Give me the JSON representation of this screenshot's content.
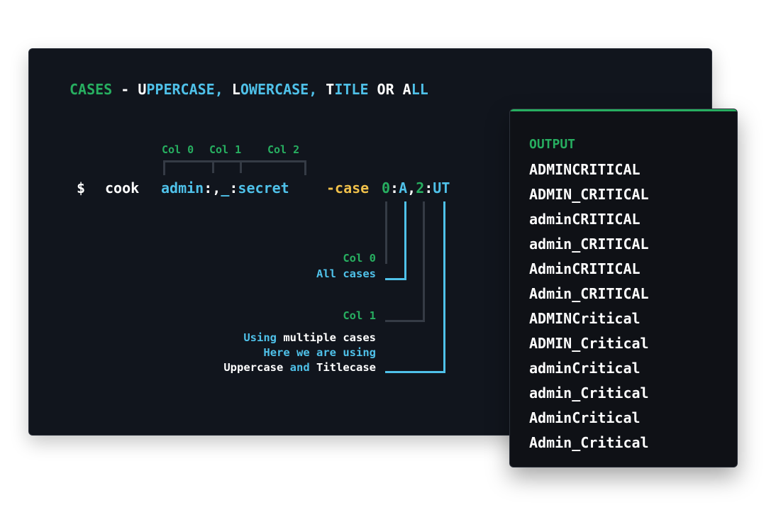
{
  "title": {
    "parts": [
      {
        "text": "CASES",
        "color": "#27ae60"
      },
      {
        "text": " - ",
        "color": "#ffffff"
      },
      {
        "text": "U",
        "color": "#ffffff"
      },
      {
        "text": "PPERCASE,",
        "color": "#4fc1e9"
      },
      {
        "text": " ",
        "color": "#ffffff"
      },
      {
        "text": "L",
        "color": "#ffffff"
      },
      {
        "text": "OWERCASE,",
        "color": "#4fc1e9"
      },
      {
        "text": " ",
        "color": "#ffffff"
      },
      {
        "text": "T",
        "color": "#ffffff"
      },
      {
        "text": "ITLE",
        "color": "#4fc1e9"
      },
      {
        "text": " OR ",
        "color": "#ffffff"
      },
      {
        "text": "A",
        "color": "#ffffff"
      },
      {
        "text": "LL",
        "color": "#4fc1e9"
      }
    ]
  },
  "columns": {
    "col0": "Col 0",
    "col1": "Col 1",
    "col2": "Col 2"
  },
  "command": {
    "prompt": "$",
    "program": "cook",
    "arg_admin": "admin",
    "arg_colon1": ":",
    "arg_comma": ",",
    "arg_underscore": "_",
    "arg_colon2": ":",
    "arg_secret": "secret",
    "flag": "-case",
    "v0": "0",
    "v_colon1": ":",
    "vA": "A",
    "v_comma": ",",
    "v2": "2",
    "v_colon2": ":",
    "vUT": "UT"
  },
  "annotations": {
    "a1_col": "Col 0",
    "a1_desc": "All cases",
    "a2_col": "Col 1",
    "a3_line1_a": "Using",
    "a3_line1_b": " multiple cases",
    "a3_line2": "Here we are using",
    "a3_line3_a": "Uppercase",
    "a3_line3_b": " and ",
    "a3_line3_c": "Titlecase"
  },
  "output": {
    "title": "OUTPUT",
    "lines": [
      "ADMINCRITICAL",
      "ADMIN_CRITICAL",
      "adminCRITICAL",
      "admin_CRITICAL",
      "AdminCRITICAL",
      "Admin_CRITICAL",
      "ADMINCritical",
      "ADMIN_Critical",
      "adminCritical",
      "admin_Critical",
      "AdminCritical",
      "Admin_Critical"
    ]
  },
  "colors": {
    "green": "#27ae60",
    "cyan": "#4fc1e9",
    "yellow": "#f0c04a",
    "white": "#ffffff",
    "panel_bg": "#11151d"
  }
}
